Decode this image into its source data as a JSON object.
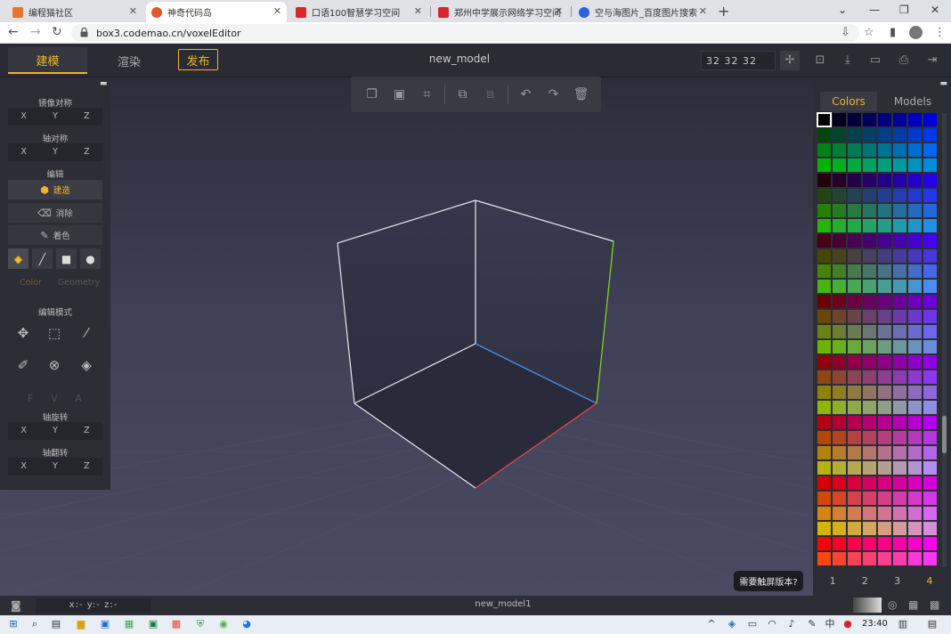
{
  "browser": {
    "tabs": [
      {
        "title": "编程猫社区",
        "icon_color": "#e8732a"
      },
      {
        "title": "神奇代码岛",
        "icon_color": "#e6572d"
      },
      {
        "title": "口语100智慧学习空间",
        "icon_color": "#d9262c"
      },
      {
        "title": "郑州中学展示网络学习空间",
        "icon_color": "#d9262c"
      },
      {
        "title": "空与海图片_百度图片搜索",
        "icon_color": "#2b62d9"
      }
    ],
    "url": "box3.codemao.cn/voxelEditor"
  },
  "header": {
    "tabs": [
      "建模",
      "渲染"
    ],
    "publish_label": "发布",
    "model_name": "new_model",
    "size_value": "32  32  32",
    "accent": "#f0b429"
  },
  "toolbar": {
    "icons": [
      "copy-icon",
      "paste-icon",
      "capture-icon",
      "duplicate-icon",
      "layer-icon",
      "undo-icon",
      "redo-icon",
      "trash-icon"
    ]
  },
  "left_panel": {
    "mirror_title": "镜像对称",
    "axis_sym_title": "轴对称",
    "edit_title": "编辑",
    "build_label": "建造",
    "erase_label": "消除",
    "paint_label": "着色",
    "color_tab": "Color",
    "geometry_tab": "Geometry",
    "edit_mode_title": "编辑模式",
    "fva": [
      "F",
      "V",
      "A"
    ],
    "rotate_title": "轴旋转",
    "flip_title": "轴翻转",
    "axes": [
      "X",
      "Y",
      "Z"
    ]
  },
  "right_panel": {
    "tabs": [
      "Colors",
      "Models"
    ],
    "pages": [
      "1",
      "2",
      "3",
      "4"
    ],
    "active_page": "4"
  },
  "touch_tip": "需要触屏版本?",
  "status": {
    "coord": "x:-  y:-  z:-",
    "model_name": "new_model1"
  },
  "taskbar": {
    "time": "23:40"
  }
}
